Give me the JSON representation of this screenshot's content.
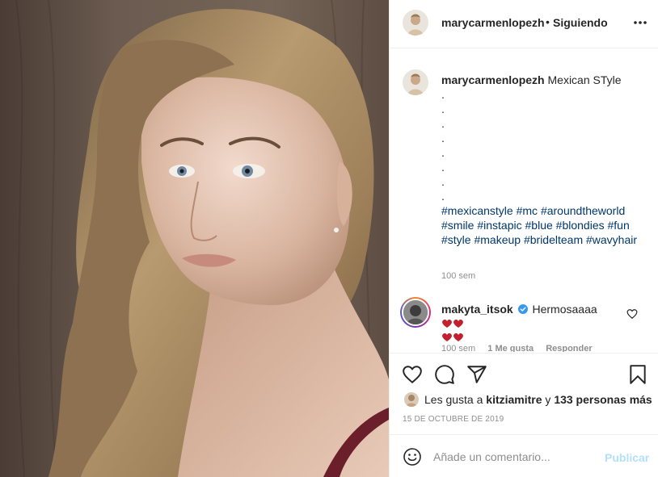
{
  "post": {
    "username": "marycarmenlopezh",
    "separator": "•",
    "follow_status": "Siguiendo",
    "more_icon": "more-options-icon"
  },
  "caption": {
    "username": "marycarmenlopezh",
    "text": "Mexican STyle",
    "dots": [
      ".",
      ".",
      ".",
      ".",
      ".",
      ".",
      ".",
      "."
    ],
    "hashtags": [
      "#mexicanstyle",
      "#mc",
      "#aroundtheworld",
      "#smile",
      "#instapic",
      "#blue",
      "#blondies",
      "#fun",
      "#style",
      "#makeup",
      "#bridelteam",
      "#wavyhair"
    ],
    "time": "100 sem"
  },
  "comment": {
    "username": "makyta_itsok",
    "text": "Hermosaaaa",
    "time": "100 sem",
    "likes": "1 Me gusta",
    "reply": "Responder"
  },
  "actions": {
    "like_icon": "heart-icon",
    "comment_icon": "comment-icon",
    "share_icon": "share-icon",
    "save_icon": "bookmark-icon"
  },
  "likes": {
    "prefix": "Les gusta a",
    "user": "kitziamitre",
    "conj": "y",
    "others": "133 personas más"
  },
  "date": "15 DE OCTUBRE DE 2019",
  "add_comment": {
    "placeholder": "Añade un comentario...",
    "publish_label": "Publicar"
  },
  "colors": {
    "text": "#262626",
    "secondary": "#8e8e8e",
    "hashtag": "#00376b",
    "publish_disabled": "#b2dffc",
    "heart_red": "#c2202f"
  }
}
